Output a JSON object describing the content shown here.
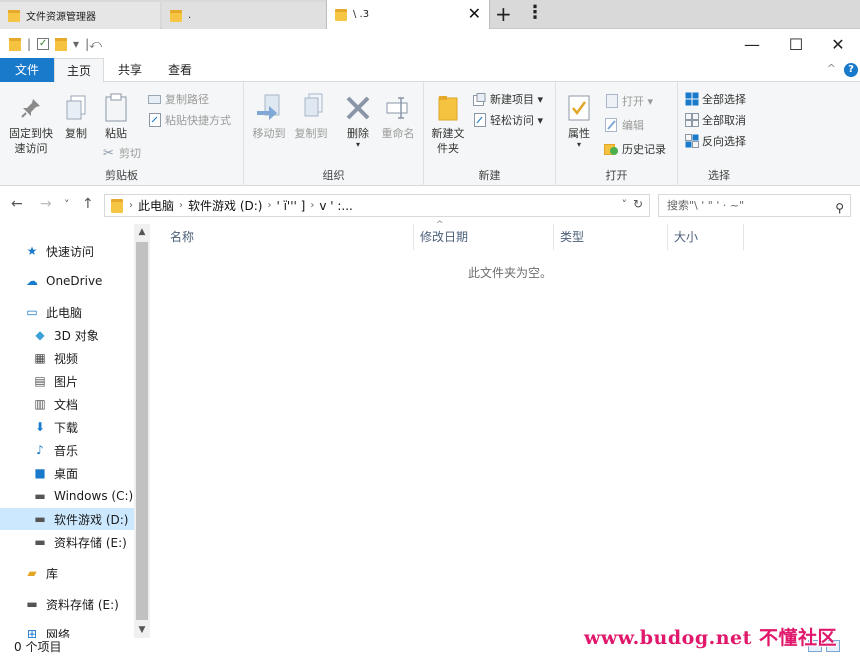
{
  "tabs": [
    {
      "label": "文件资源管理器"
    },
    {
      "label": "."
    },
    {
      "label": "\\ .3"
    }
  ],
  "quick_access_toolbar": {
    "sep": "|",
    "dropdown": "▾",
    "extra": "|⤺"
  },
  "window": {
    "minimize": "—",
    "maximize": "☐",
    "close": "✕"
  },
  "ribbon_tabs": {
    "file": "文件",
    "home": "主页",
    "share": "共享",
    "view": "查看"
  },
  "ribbon": {
    "clipboard": {
      "label": "剪贴板",
      "pin": "固定到快速访问",
      "copy": "复制",
      "paste": "粘贴",
      "copy_path": "复制路径",
      "paste_shortcut": "粘贴快捷方式",
      "cut": "剪切"
    },
    "organize": {
      "label": "组织",
      "move_to": "移动到",
      "copy_to": "复制到",
      "delete": "删除",
      "rename": "重命名"
    },
    "new": {
      "label": "新建",
      "new_folder": "新建文件夹",
      "new_item": "新建项目 ▾",
      "easy_access": "轻松访问 ▾"
    },
    "open": {
      "label": "打开",
      "properties": "属性",
      "open": "打开 ▾",
      "edit": "编辑",
      "history": "历史记录"
    },
    "select": {
      "label": "选择",
      "select_all": "全部选择",
      "select_none": "全部取消",
      "invert": "反向选择"
    }
  },
  "address": {
    "back": "←",
    "forward": "→",
    "recent": "˅",
    "up": "↑",
    "segments": [
      "此电脑",
      "软件游戏 (D:)",
      "' ï''' ] ",
      "v ' :..."
    ],
    "sep": "›",
    "dropdown": "˅",
    "refresh": "↻",
    "search_placeholder": "搜索\"\\ ' \" ' · ~\"",
    "search_icon": "⚲"
  },
  "nav": {
    "items": [
      {
        "label": "快速访问",
        "icon": "★",
        "color": "#1979ca"
      },
      {
        "label": "OneDrive",
        "icon": "☁",
        "color": "#1979ca"
      },
      {
        "label": "此电脑",
        "icon": "▭",
        "color": "#1979ca"
      },
      {
        "label": "3D 对象",
        "icon": "◆",
        "color": "#3aa0d8"
      },
      {
        "label": "视频",
        "icon": "▦",
        "color": "#444"
      },
      {
        "label": "图片",
        "icon": "▤",
        "color": "#555"
      },
      {
        "label": "文档",
        "icon": "▥",
        "color": "#555"
      },
      {
        "label": "下载",
        "icon": "⬇",
        "color": "#1979ca"
      },
      {
        "label": "音乐",
        "icon": "♪",
        "color": "#1979ca"
      },
      {
        "label": "桌面",
        "icon": "■",
        "color": "#1979ca"
      },
      {
        "label": "Windows (C:)",
        "icon": "▬",
        "color": "#555"
      },
      {
        "label": "软件游戏 (D:)",
        "icon": "▬",
        "color": "#555"
      },
      {
        "label": "资料存储 (E:)",
        "icon": "▬",
        "color": "#555"
      },
      {
        "label": "库",
        "icon": "▰",
        "color": "#e2a524"
      },
      {
        "label": "资料存储 (E:)",
        "icon": "▬",
        "color": "#555"
      },
      {
        "label": "网络",
        "icon": "⊞",
        "color": "#1979ca"
      }
    ],
    "scroll_up": "▲",
    "scroll_down": "▼"
  },
  "content": {
    "columns": [
      "名称",
      "修改日期",
      "类型",
      "大小"
    ],
    "sort_indicator": "^",
    "empty_message": "此文件夹为空。"
  },
  "status": {
    "item_count": "0 个项目"
  },
  "watermark": "www.budog.net 不懂社区"
}
